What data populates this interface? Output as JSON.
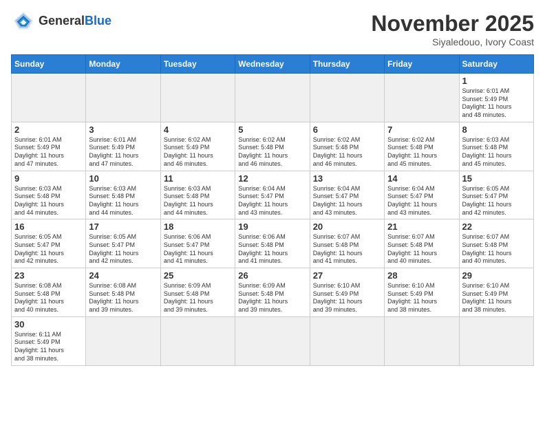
{
  "header": {
    "logo_general": "General",
    "logo_blue": "Blue",
    "month_title": "November 2025",
    "location": "Siyaledouo, Ivory Coast"
  },
  "days_of_week": [
    "Sunday",
    "Monday",
    "Tuesday",
    "Wednesday",
    "Thursday",
    "Friday",
    "Saturday"
  ],
  "weeks": [
    [
      {
        "day": "",
        "info": "",
        "empty": true
      },
      {
        "day": "",
        "info": "",
        "empty": true
      },
      {
        "day": "",
        "info": "",
        "empty": true
      },
      {
        "day": "",
        "info": "",
        "empty": true
      },
      {
        "day": "",
        "info": "",
        "empty": true
      },
      {
        "day": "",
        "info": "",
        "empty": true
      },
      {
        "day": "1",
        "info": "Sunrise: 6:01 AM\nSunset: 5:49 PM\nDaylight: 11 hours\nand 48 minutes."
      }
    ],
    [
      {
        "day": "2",
        "info": "Sunrise: 6:01 AM\nSunset: 5:49 PM\nDaylight: 11 hours\nand 47 minutes."
      },
      {
        "day": "3",
        "info": "Sunrise: 6:01 AM\nSunset: 5:49 PM\nDaylight: 11 hours\nand 47 minutes."
      },
      {
        "day": "4",
        "info": "Sunrise: 6:02 AM\nSunset: 5:49 PM\nDaylight: 11 hours\nand 46 minutes."
      },
      {
        "day": "5",
        "info": "Sunrise: 6:02 AM\nSunset: 5:48 PM\nDaylight: 11 hours\nand 46 minutes."
      },
      {
        "day": "6",
        "info": "Sunrise: 6:02 AM\nSunset: 5:48 PM\nDaylight: 11 hours\nand 46 minutes."
      },
      {
        "day": "7",
        "info": "Sunrise: 6:02 AM\nSunset: 5:48 PM\nDaylight: 11 hours\nand 45 minutes."
      },
      {
        "day": "8",
        "info": "Sunrise: 6:03 AM\nSunset: 5:48 PM\nDaylight: 11 hours\nand 45 minutes."
      }
    ],
    [
      {
        "day": "9",
        "info": "Sunrise: 6:03 AM\nSunset: 5:48 PM\nDaylight: 11 hours\nand 44 minutes."
      },
      {
        "day": "10",
        "info": "Sunrise: 6:03 AM\nSunset: 5:48 PM\nDaylight: 11 hours\nand 44 minutes."
      },
      {
        "day": "11",
        "info": "Sunrise: 6:03 AM\nSunset: 5:48 PM\nDaylight: 11 hours\nand 44 minutes."
      },
      {
        "day": "12",
        "info": "Sunrise: 6:04 AM\nSunset: 5:47 PM\nDaylight: 11 hours\nand 43 minutes."
      },
      {
        "day": "13",
        "info": "Sunrise: 6:04 AM\nSunset: 5:47 PM\nDaylight: 11 hours\nand 43 minutes."
      },
      {
        "day": "14",
        "info": "Sunrise: 6:04 AM\nSunset: 5:47 PM\nDaylight: 11 hours\nand 43 minutes."
      },
      {
        "day": "15",
        "info": "Sunrise: 6:05 AM\nSunset: 5:47 PM\nDaylight: 11 hours\nand 42 minutes."
      }
    ],
    [
      {
        "day": "16",
        "info": "Sunrise: 6:05 AM\nSunset: 5:47 PM\nDaylight: 11 hours\nand 42 minutes."
      },
      {
        "day": "17",
        "info": "Sunrise: 6:05 AM\nSunset: 5:47 PM\nDaylight: 11 hours\nand 42 minutes."
      },
      {
        "day": "18",
        "info": "Sunrise: 6:06 AM\nSunset: 5:47 PM\nDaylight: 11 hours\nand 41 minutes."
      },
      {
        "day": "19",
        "info": "Sunrise: 6:06 AM\nSunset: 5:48 PM\nDaylight: 11 hours\nand 41 minutes."
      },
      {
        "day": "20",
        "info": "Sunrise: 6:07 AM\nSunset: 5:48 PM\nDaylight: 11 hours\nand 41 minutes."
      },
      {
        "day": "21",
        "info": "Sunrise: 6:07 AM\nSunset: 5:48 PM\nDaylight: 11 hours\nand 40 minutes."
      },
      {
        "day": "22",
        "info": "Sunrise: 6:07 AM\nSunset: 5:48 PM\nDaylight: 11 hours\nand 40 minutes."
      }
    ],
    [
      {
        "day": "23",
        "info": "Sunrise: 6:08 AM\nSunset: 5:48 PM\nDaylight: 11 hours\nand 40 minutes."
      },
      {
        "day": "24",
        "info": "Sunrise: 6:08 AM\nSunset: 5:48 PM\nDaylight: 11 hours\nand 39 minutes."
      },
      {
        "day": "25",
        "info": "Sunrise: 6:09 AM\nSunset: 5:48 PM\nDaylight: 11 hours\nand 39 minutes."
      },
      {
        "day": "26",
        "info": "Sunrise: 6:09 AM\nSunset: 5:48 PM\nDaylight: 11 hours\nand 39 minutes."
      },
      {
        "day": "27",
        "info": "Sunrise: 6:10 AM\nSunset: 5:49 PM\nDaylight: 11 hours\nand 39 minutes."
      },
      {
        "day": "28",
        "info": "Sunrise: 6:10 AM\nSunset: 5:49 PM\nDaylight: 11 hours\nand 38 minutes."
      },
      {
        "day": "29",
        "info": "Sunrise: 6:10 AM\nSunset: 5:49 PM\nDaylight: 11 hours\nand 38 minutes."
      }
    ],
    [
      {
        "day": "30",
        "info": "Sunrise: 6:11 AM\nSunset: 5:49 PM\nDaylight: 11 hours\nand 38 minutes."
      },
      {
        "day": "",
        "info": "",
        "empty": true
      },
      {
        "day": "",
        "info": "",
        "empty": true
      },
      {
        "day": "",
        "info": "",
        "empty": true
      },
      {
        "day": "",
        "info": "",
        "empty": true
      },
      {
        "day": "",
        "info": "",
        "empty": true
      },
      {
        "day": "",
        "info": "",
        "empty": true
      }
    ]
  ]
}
